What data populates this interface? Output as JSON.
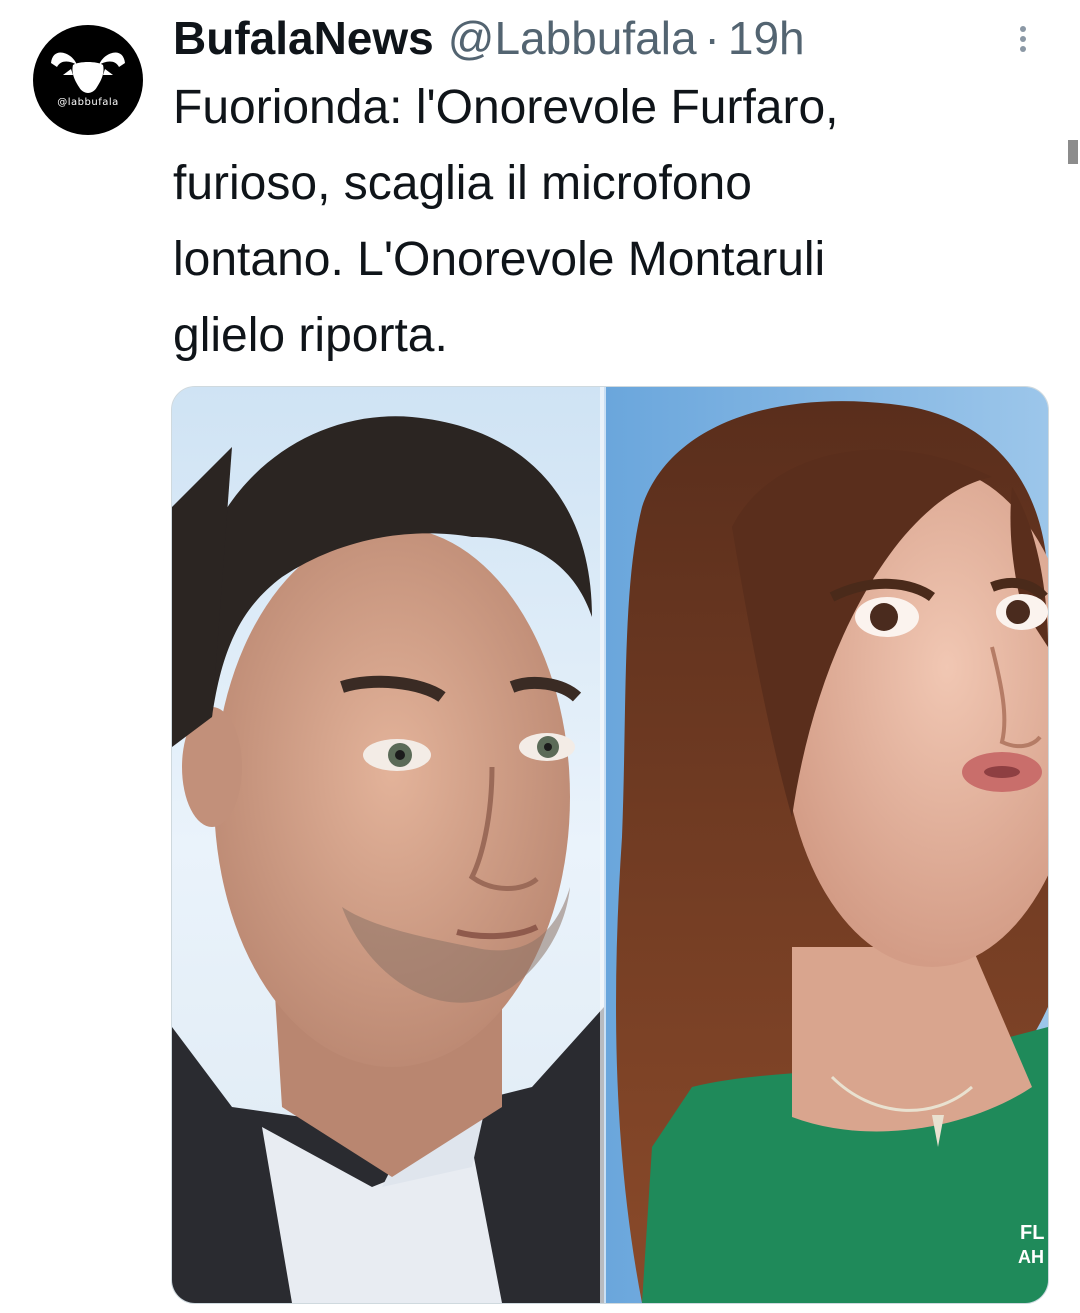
{
  "tweet": {
    "avatar_text": "@labbufala",
    "display_name": "BufalaNews",
    "handle": "@Labbufala",
    "separator": "·",
    "time": "19h",
    "text": "Fuorionda: l'Onorevole Furfaro,\nfurioso, scaglia il microfono\nlontano. L'Onorevole Montaruli\nglielo riporta.",
    "media": {
      "studio_logo_text": "FL\nAH"
    }
  },
  "icons": {
    "avatar": "buffalo-head-icon",
    "more": "more-vertical-icon"
  },
  "colors": {
    "text_primary": "#0f1419",
    "text_secondary": "#536471",
    "avatar_bg": "#000000",
    "media_border": "#cfd9de"
  }
}
